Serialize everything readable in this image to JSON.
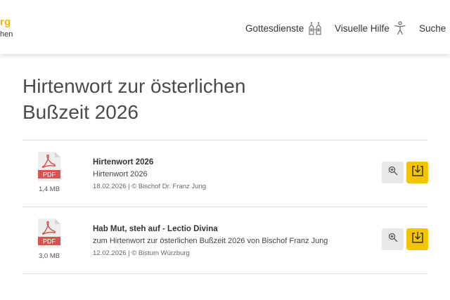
{
  "brand": {
    "line1": "rg",
    "line2": "hen",
    "color": "#f2b705"
  },
  "nav": {
    "items": [
      {
        "label": "Gottesdienste",
        "icon": "church-icon"
      },
      {
        "label": "Visuelle Hilfe",
        "icon": "accessibility-icon"
      },
      {
        "label": "Suche",
        "icon": "search-icon"
      }
    ]
  },
  "page": {
    "title": "Hirtenwort zur österlichen Bußzeit 2026"
  },
  "documents": [
    {
      "badge": "PDF",
      "size": "1,4 MB",
      "title": "Hirtenwort 2026",
      "subtitle": "Hirtenwort 2026",
      "meta": "18.02.2026 | © Bischof Dr. Franz Jung"
    },
    {
      "badge": "PDF",
      "size": "3,0 MB",
      "title": "Hab Mut, steh auf - Lectio Divina",
      "subtitle": "zum Hirtenwort zur österlichen Bußzeit 2026 von Bischof Franz Jung",
      "meta": "12.02.2026 | © Bistum Würzburg"
    }
  ],
  "colors": {
    "accent": "#f5c400",
    "pdf_red": "#d9534f",
    "zoom_bg": "#e8e8e8"
  }
}
